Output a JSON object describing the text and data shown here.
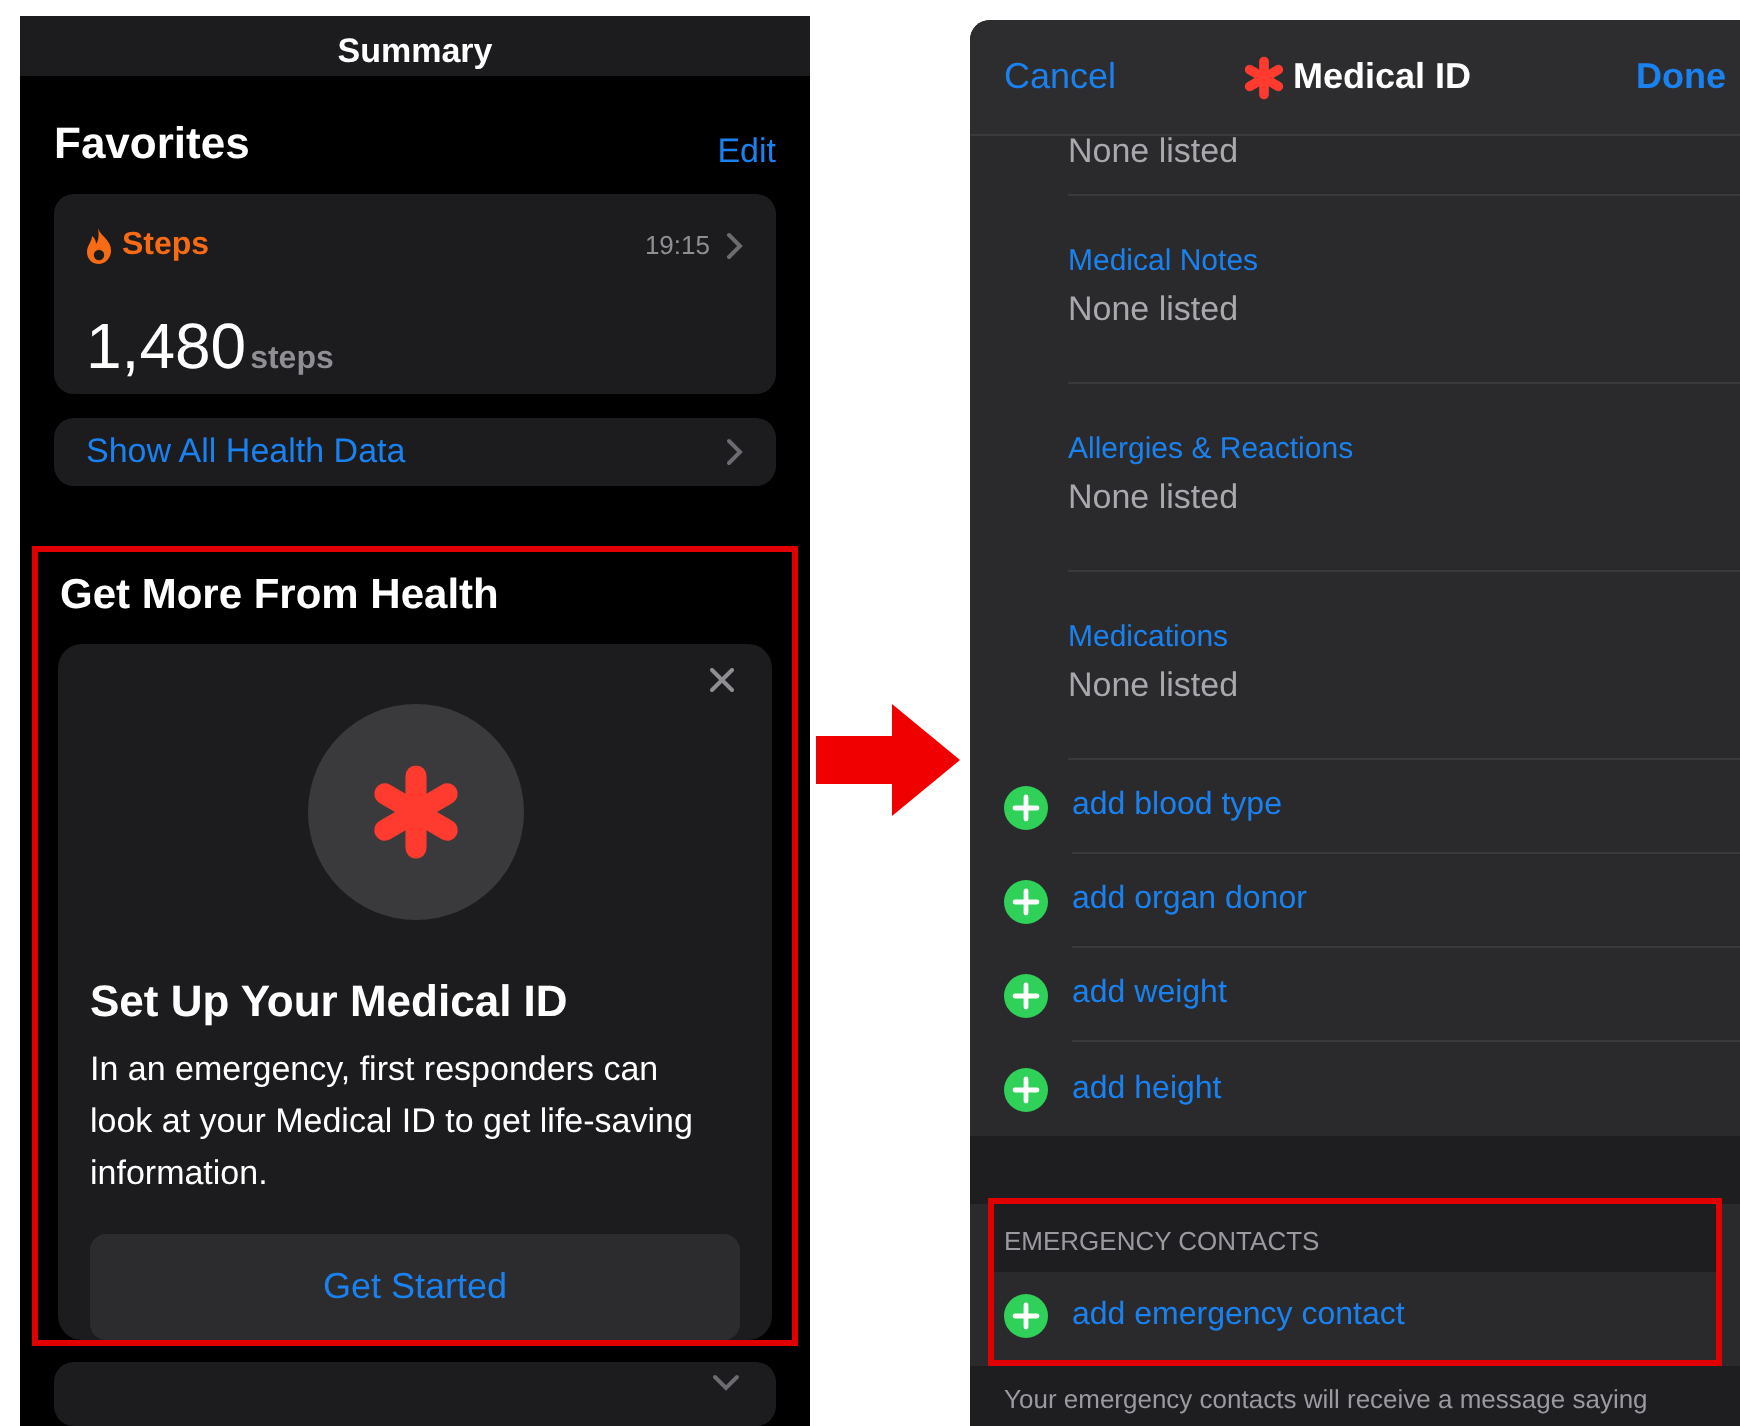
{
  "left_screen": {
    "title": "Summary",
    "favorites": {
      "heading": "Favorites",
      "edit": "Edit",
      "metric": {
        "name": "Steps",
        "time": "19:15",
        "value": "1,480",
        "unit": "steps"
      },
      "show_all": "Show All Health Data"
    },
    "promo": {
      "heading": "Get More From Health",
      "highlighted": true,
      "title": "Set Up Your Medical ID",
      "description": "In an emergency, first responders can look at your Medical ID to get life-saving information.",
      "button": "Get Started"
    }
  },
  "right_screen": {
    "nav": {
      "cancel": "Cancel",
      "title": "Medical ID",
      "done": "Done"
    },
    "fields": [
      {
        "value": "None listed"
      },
      {
        "label": "Medical Notes",
        "value": "None listed"
      },
      {
        "label": "Allergies & Reactions",
        "value": "None listed"
      },
      {
        "label": "Medications",
        "value": "None listed"
      }
    ],
    "add_items": [
      "add blood type",
      "add organ donor",
      "add weight",
      "add height"
    ],
    "emergency": {
      "header": "EMERGENCY CONTACTS",
      "highlighted": true,
      "add": "add emergency contact",
      "footer": "Your emergency contacts will receive a message saying"
    }
  }
}
